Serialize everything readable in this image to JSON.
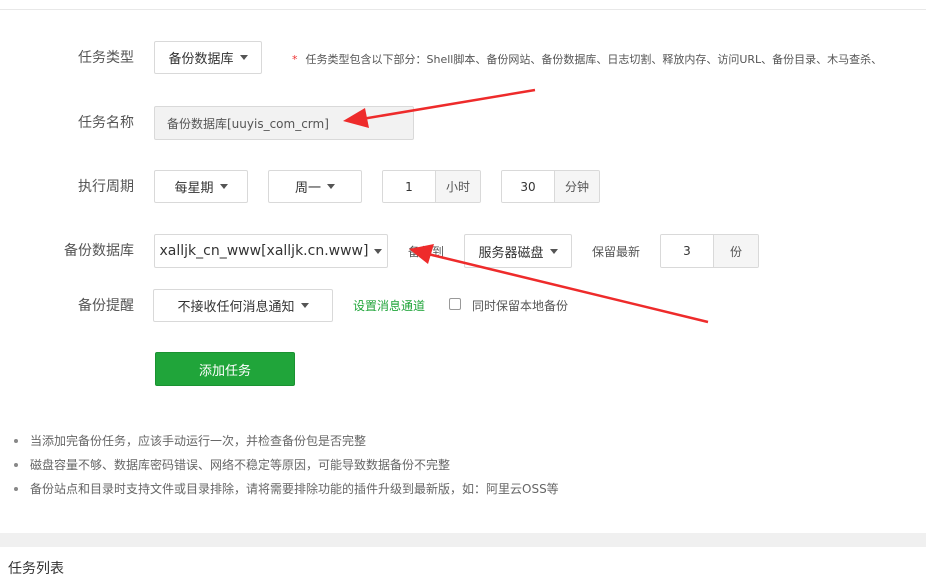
{
  "task_type": {
    "label": "任务类型",
    "value": "备份数据库",
    "hint_star": "*",
    "hint": "任务类型包含以下部分：Shell脚本、备份网站、备份数据库、日志切割、释放内存、访问URL、备份目录、木马查杀、"
  },
  "task_name": {
    "label": "任务名称",
    "value": "备份数据库[uuyis_com_crm]"
  },
  "schedule": {
    "label": "执行周期",
    "period": "每星期",
    "weekday": "周一",
    "hour_value": "1",
    "hour_unit": "小时",
    "minute_value": "30",
    "minute_unit": "分钟"
  },
  "backup_db": {
    "label": "备份数据库",
    "database": "xalljk_cn_www[xalljk.cn.www]",
    "backup_to_label": "备份到",
    "backup_target": "服务器磁盘",
    "keep_label": "保留最新",
    "keep_value": "3",
    "keep_unit": "份"
  },
  "backup_notify": {
    "label": "备份提醒",
    "value": "不接收任何消息通知",
    "setup_link": "设置消息通道",
    "keep_local_label": "同时保留本地备份",
    "keep_local_checked": false
  },
  "add_button": "添加任务",
  "notes": [
    "当添加完备份任务，应该手动运行一次，并检查备份包是否完整",
    "磁盘容量不够、数据库密码错误、网络不稳定等原因，可能导致数据备份不完整",
    "备份站点和目录时支持文件或目录排除，请将需要排除功能的插件升级到最新版，如：阿里云OSS等"
  ],
  "task_list_title": "任务列表",
  "colors": {
    "accent_green": "#20a53a",
    "annotation_red": "#ee2b2b",
    "hint_star": "#ee3333"
  }
}
